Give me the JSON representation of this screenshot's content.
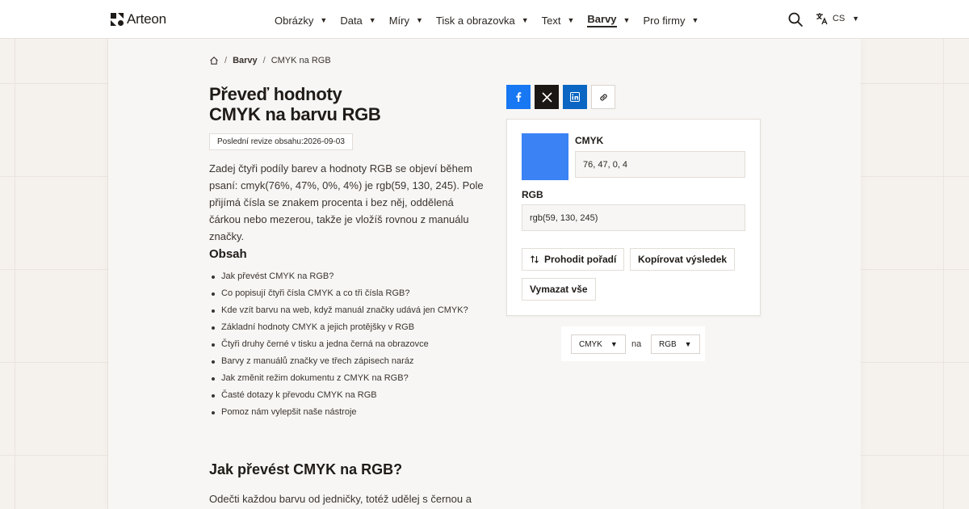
{
  "header": {
    "logo_text": "Arteon",
    "nav": [
      {
        "label": "Obrázky",
        "active": false
      },
      {
        "label": "Data",
        "active": false
      },
      {
        "label": "Míry",
        "active": false
      },
      {
        "label": "Tisk a obrazovka",
        "active": false
      },
      {
        "label": "Text",
        "active": false
      },
      {
        "label": "Barvy",
        "active": true
      },
      {
        "label": "Pro firmy",
        "active": false
      }
    ],
    "language": "CS",
    "icons": {
      "search": "search-icon",
      "language": "translate-icon",
      "caret": "caret-down-icon"
    }
  },
  "breadcrumb": {
    "home_icon": "home-icon",
    "section": "Barvy",
    "current": "CMYK na RGB"
  },
  "page": {
    "title_line1": "Převeď hodnoty",
    "title_line2": "CMYK na barvu RGB",
    "revision": "Poslední revize obsahu:2026-09-03",
    "intro": "Zadej čtyři podíly barev a hodnoty RGB se objeví během psaní: cmyk(76%, 47%, 0%, 4%) je rgb(59, 130, 245). Pole přijímá čísla se znakem procenta i bez něj, oddělená čárkou nebo mezerou, takže je vložíš rovnou z manuálu značky."
  },
  "toc": {
    "title": "Obsah",
    "items": [
      "Jak převést CMYK na RGB?",
      "Co popisují čtyři čísla CMYK a co tři čísla RGB?",
      "Kde vzít barvu na web, když manuál značky udává jen CMYK?",
      "Základní hodnoty CMYK a jejich protějšky v RGB",
      "Čtyři druhy černé v tisku a jedna černá na obrazovce",
      "Barvy z manuálů značky ve třech zápisech naráz",
      "Jak změnit režim dokumentu z CMYK na RGB?",
      "Časté dotazy k převodu CMYK na RGB",
      "Pomoz nám vylepšit naše nástroje"
    ]
  },
  "section": {
    "title": "Jak převést CMYK na RGB?",
    "text": "Odečti každou barvu od jedničky, totéž udělej s černou a"
  },
  "share": {
    "icons": [
      "facebook-icon",
      "x-icon",
      "linkedin-icon",
      "link-icon"
    ]
  },
  "converter": {
    "swatch_color": "#3b82f5",
    "cmyk_label": "CMYK",
    "cmyk_value": "76, 47, 0, 4",
    "rgb_label": "RGB",
    "rgb_value": "rgb(59, 130, 245)",
    "swap_label": "Prohodit pořadí",
    "swap_icon": "swap-arrows-icon",
    "copy_label": "Kopírovat výsledek",
    "clear_label": "Vymazat vše"
  },
  "mode": {
    "from": "CMYK",
    "to_word": "na",
    "to": "RGB"
  },
  "colors": {
    "facebook": "#1877f2",
    "x": "#1b1714",
    "linkedin": "#0a66c2",
    "page_bg": "#f5f1ed",
    "card_bg": "#f8f6f4"
  }
}
